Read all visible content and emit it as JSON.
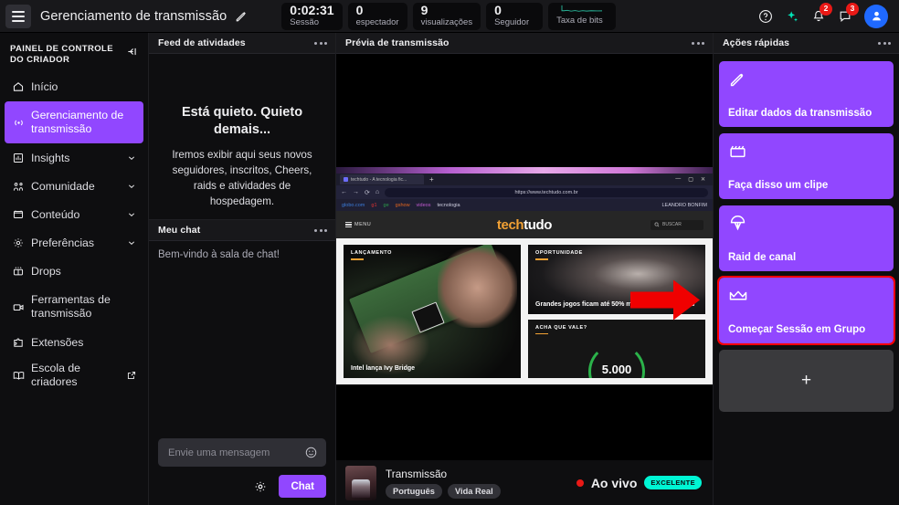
{
  "topbar": {
    "menu_icon": "hamburger-icon",
    "title": "Gerenciamento de transmissão",
    "edit_icon": "pencil-icon",
    "stats": [
      {
        "value": "0:02:31",
        "label": "Sessão"
      },
      {
        "value": "0",
        "label": "espectador"
      },
      {
        "value": "9",
        "label": "visualizações"
      },
      {
        "value": "0",
        "label": "Seguidor"
      }
    ],
    "bitrate": {
      "label": "Taxa de bits",
      "icon": "sparkline-chart",
      "color": "#28b79a"
    },
    "icons": [
      {
        "name": "help-icon",
        "badge": ""
      },
      {
        "name": "sparkle-icon",
        "badge": ""
      },
      {
        "name": "bell-icon",
        "badge": "2"
      },
      {
        "name": "whispers-icon",
        "badge": "3"
      }
    ],
    "avatar": {
      "name": "avatar",
      "color": "#1f69ff"
    }
  },
  "sidebar": {
    "heading": "PAINEL DE CONTROLE DO CRIADOR",
    "collapse_icon": "collapse-sidebar-icon",
    "items": [
      {
        "label": "Início",
        "icon": "home-icon",
        "active": false,
        "chevron": false,
        "external": false
      },
      {
        "label": "Gerenciamento de transmissão",
        "icon": "broadcast-icon",
        "active": true,
        "chevron": false,
        "external": false
      },
      {
        "label": "Insights",
        "icon": "chart-icon",
        "active": false,
        "chevron": true,
        "external": false
      },
      {
        "label": "Comunidade",
        "icon": "community-icon",
        "active": false,
        "chevron": true,
        "external": false
      },
      {
        "label": "Conteúdo",
        "icon": "content-icon",
        "active": false,
        "chevron": true,
        "external": false
      },
      {
        "label": "Preferências",
        "icon": "gear-icon",
        "active": false,
        "chevron": true,
        "external": false
      },
      {
        "label": "Drops",
        "icon": "drops-icon",
        "active": false,
        "chevron": false,
        "external": false
      },
      {
        "label": "Ferramentas de transmissão",
        "icon": "camera-icon",
        "active": false,
        "chevron": false,
        "external": false
      },
      {
        "label": "Extensões",
        "icon": "extensions-icon",
        "active": false,
        "chevron": false,
        "external": false
      },
      {
        "label": "Escola de criadores",
        "icon": "book-icon",
        "active": false,
        "chevron": false,
        "external": true
      }
    ]
  },
  "activity_feed": {
    "title": "Feed de atividades",
    "more_icon": "more-options-icon",
    "empty_heading": "Está quieto. Quieto demais...",
    "empty_text": "Iremos exibir aqui seus novos seguidores, inscritos, Cheers, raids e atividades de hospedagem."
  },
  "chat": {
    "title": "Meu chat",
    "more_icon": "more-options-icon",
    "welcome": "Bem-vindo à sala de chat!",
    "input_placeholder": "Envie uma mensagem",
    "input_value": "",
    "emoji_icon": "emoji-icon",
    "settings_icon": "gear-icon",
    "send_label": "Chat"
  },
  "preview": {
    "title": "Prévia de transmissão",
    "more_icon": "more-options-icon",
    "browser": {
      "tab_title": "techtudo - A tecnologia fic...",
      "url": "https://www.techtudo.com.br",
      "account": "LEANDRO BONFIM",
      "bookmarks": [
        "globo.com",
        "g1",
        "ge",
        "gshow",
        "videos",
        "tecnologia"
      ],
      "site_logo_left": "tech",
      "site_logo_right": "tudo",
      "menu_label": "MENU",
      "search_label": "BUSCAR",
      "cards": [
        {
          "kicker": "LANÇAMENTO",
          "headline": "Intel lança Ivy Bridge"
        },
        {
          "kicker": "OPORTUNIDADE",
          "headline": "Grandes jogos ficam até 50% mais baratos este mês"
        },
        {
          "kicker": "ACHA QUE VALE?",
          "headline": "5.000"
        }
      ]
    },
    "stream": {
      "name": "Transmissão",
      "tags": [
        "Português",
        "Vida Real"
      ],
      "live_label": "Ao vivo",
      "quality_badge": "EXCELENTE"
    }
  },
  "quick_actions": {
    "title": "Ações rápidas",
    "more_icon": "more-options-icon",
    "accent": "#9147ff",
    "selection_outline": "#ff0000",
    "cards": [
      {
        "label": "Editar dados da transmissão",
        "icon": "pencil-icon",
        "selected": false
      },
      {
        "label": "Faça disso um clipe",
        "icon": "clip-icon",
        "selected": false
      },
      {
        "label": "Raid de canal",
        "icon": "raid-icon",
        "selected": false
      },
      {
        "label": "Começar Sessão em Grupo",
        "icon": "crown-icon",
        "selected": true
      }
    ],
    "add_label": "+"
  }
}
